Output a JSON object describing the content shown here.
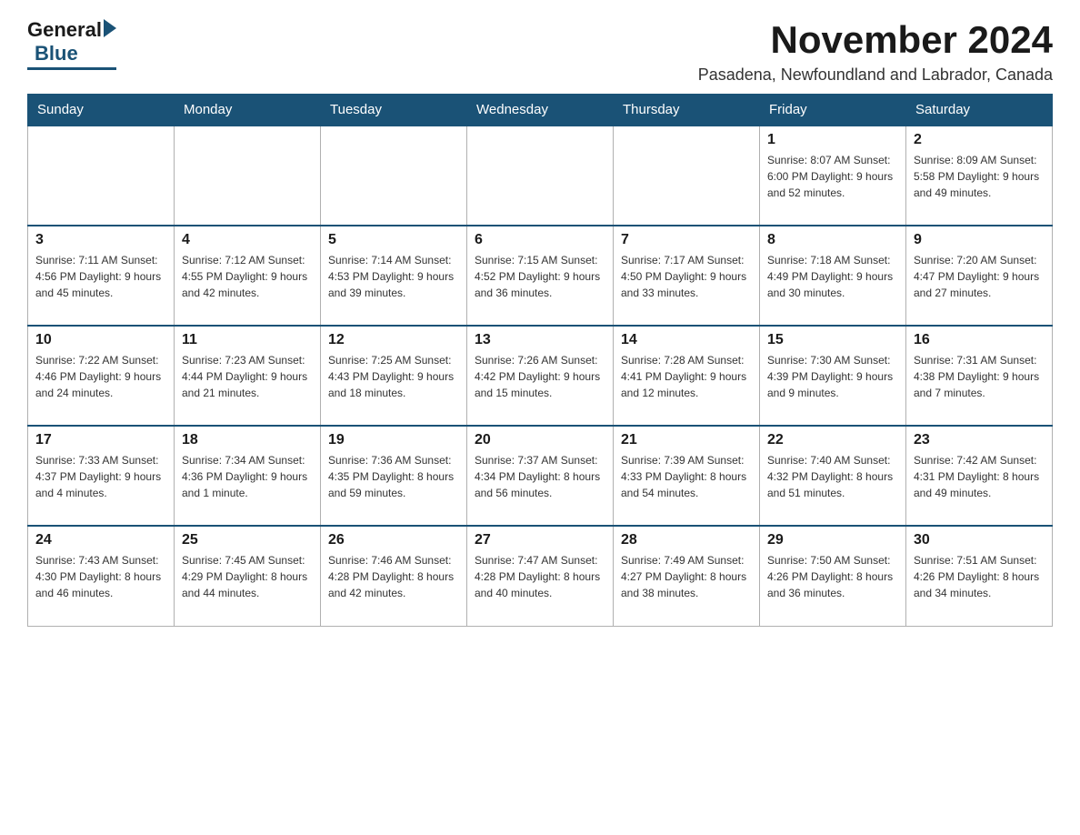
{
  "logo": {
    "general": "General",
    "blue": "Blue"
  },
  "header": {
    "month": "November 2024",
    "location": "Pasadena, Newfoundland and Labrador, Canada"
  },
  "days_of_week": [
    "Sunday",
    "Monday",
    "Tuesday",
    "Wednesday",
    "Thursday",
    "Friday",
    "Saturday"
  ],
  "weeks": [
    [
      {
        "day": "",
        "info": ""
      },
      {
        "day": "",
        "info": ""
      },
      {
        "day": "",
        "info": ""
      },
      {
        "day": "",
        "info": ""
      },
      {
        "day": "",
        "info": ""
      },
      {
        "day": "1",
        "info": "Sunrise: 8:07 AM\nSunset: 6:00 PM\nDaylight: 9 hours and 52 minutes."
      },
      {
        "day": "2",
        "info": "Sunrise: 8:09 AM\nSunset: 5:58 PM\nDaylight: 9 hours and 49 minutes."
      }
    ],
    [
      {
        "day": "3",
        "info": "Sunrise: 7:11 AM\nSunset: 4:56 PM\nDaylight: 9 hours and 45 minutes."
      },
      {
        "day": "4",
        "info": "Sunrise: 7:12 AM\nSunset: 4:55 PM\nDaylight: 9 hours and 42 minutes."
      },
      {
        "day": "5",
        "info": "Sunrise: 7:14 AM\nSunset: 4:53 PM\nDaylight: 9 hours and 39 minutes."
      },
      {
        "day": "6",
        "info": "Sunrise: 7:15 AM\nSunset: 4:52 PM\nDaylight: 9 hours and 36 minutes."
      },
      {
        "day": "7",
        "info": "Sunrise: 7:17 AM\nSunset: 4:50 PM\nDaylight: 9 hours and 33 minutes."
      },
      {
        "day": "8",
        "info": "Sunrise: 7:18 AM\nSunset: 4:49 PM\nDaylight: 9 hours and 30 minutes."
      },
      {
        "day": "9",
        "info": "Sunrise: 7:20 AM\nSunset: 4:47 PM\nDaylight: 9 hours and 27 minutes."
      }
    ],
    [
      {
        "day": "10",
        "info": "Sunrise: 7:22 AM\nSunset: 4:46 PM\nDaylight: 9 hours and 24 minutes."
      },
      {
        "day": "11",
        "info": "Sunrise: 7:23 AM\nSunset: 4:44 PM\nDaylight: 9 hours and 21 minutes."
      },
      {
        "day": "12",
        "info": "Sunrise: 7:25 AM\nSunset: 4:43 PM\nDaylight: 9 hours and 18 minutes."
      },
      {
        "day": "13",
        "info": "Sunrise: 7:26 AM\nSunset: 4:42 PM\nDaylight: 9 hours and 15 minutes."
      },
      {
        "day": "14",
        "info": "Sunrise: 7:28 AM\nSunset: 4:41 PM\nDaylight: 9 hours and 12 minutes."
      },
      {
        "day": "15",
        "info": "Sunrise: 7:30 AM\nSunset: 4:39 PM\nDaylight: 9 hours and 9 minutes."
      },
      {
        "day": "16",
        "info": "Sunrise: 7:31 AM\nSunset: 4:38 PM\nDaylight: 9 hours and 7 minutes."
      }
    ],
    [
      {
        "day": "17",
        "info": "Sunrise: 7:33 AM\nSunset: 4:37 PM\nDaylight: 9 hours and 4 minutes."
      },
      {
        "day": "18",
        "info": "Sunrise: 7:34 AM\nSunset: 4:36 PM\nDaylight: 9 hours and 1 minute."
      },
      {
        "day": "19",
        "info": "Sunrise: 7:36 AM\nSunset: 4:35 PM\nDaylight: 8 hours and 59 minutes."
      },
      {
        "day": "20",
        "info": "Sunrise: 7:37 AM\nSunset: 4:34 PM\nDaylight: 8 hours and 56 minutes."
      },
      {
        "day": "21",
        "info": "Sunrise: 7:39 AM\nSunset: 4:33 PM\nDaylight: 8 hours and 54 minutes."
      },
      {
        "day": "22",
        "info": "Sunrise: 7:40 AM\nSunset: 4:32 PM\nDaylight: 8 hours and 51 minutes."
      },
      {
        "day": "23",
        "info": "Sunrise: 7:42 AM\nSunset: 4:31 PM\nDaylight: 8 hours and 49 minutes."
      }
    ],
    [
      {
        "day": "24",
        "info": "Sunrise: 7:43 AM\nSunset: 4:30 PM\nDaylight: 8 hours and 46 minutes."
      },
      {
        "day": "25",
        "info": "Sunrise: 7:45 AM\nSunset: 4:29 PM\nDaylight: 8 hours and 44 minutes."
      },
      {
        "day": "26",
        "info": "Sunrise: 7:46 AM\nSunset: 4:28 PM\nDaylight: 8 hours and 42 minutes."
      },
      {
        "day": "27",
        "info": "Sunrise: 7:47 AM\nSunset: 4:28 PM\nDaylight: 8 hours and 40 minutes."
      },
      {
        "day": "28",
        "info": "Sunrise: 7:49 AM\nSunset: 4:27 PM\nDaylight: 8 hours and 38 minutes."
      },
      {
        "day": "29",
        "info": "Sunrise: 7:50 AM\nSunset: 4:26 PM\nDaylight: 8 hours and 36 minutes."
      },
      {
        "day": "30",
        "info": "Sunrise: 7:51 AM\nSunset: 4:26 PM\nDaylight: 8 hours and 34 minutes."
      }
    ]
  ]
}
